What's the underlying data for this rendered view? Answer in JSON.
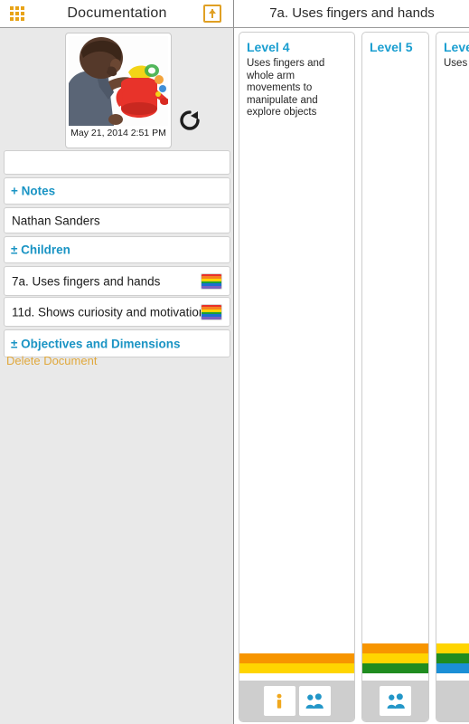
{
  "header": {
    "grid_icon": "grid-menu-icon",
    "doc_title": "Documentation",
    "export_icon": "export-upload-icon",
    "objective_title": "7a. Uses fingers and hands"
  },
  "left_panel": {
    "photo": {
      "caption": "May  21, 2014 2:51 PM",
      "alt": "child-with-red-watering-can-photo"
    },
    "rotate_icon": "rotate-clockwise-icon",
    "rows": [
      {
        "name": "blank-field",
        "value": "",
        "type": "input",
        "placeholder": ""
      },
      {
        "name": "notes-toggle",
        "value": "+ Notes",
        "type": "link"
      },
      {
        "name": "child-name-field",
        "value": "Nathan Sanders",
        "type": "input"
      },
      {
        "name": "children-toggle",
        "value": "± Children",
        "type": "link"
      },
      {
        "name": "objective-7a",
        "value": "7a. Uses fingers and hands",
        "type": "item",
        "badge": "rainbow"
      },
      {
        "name": "objective-11d",
        "value": "11d. Shows curiosity and motivation",
        "type": "item",
        "badge": "rainbow"
      },
      {
        "name": "objectives-dimensions-toggle",
        "value": "± Objectives and Dimensions",
        "type": "link"
      }
    ],
    "delete_label": "Delete Document"
  },
  "right_panel": {
    "columns": [
      {
        "level": "Level 4",
        "description": "Uses fingers and whole arm movements to manipulate and explore objects",
        "bars": [
          "#f79500",
          "#ffd500"
        ],
        "footer_icons": [
          "info-icon",
          "children-people-icon"
        ]
      },
      {
        "level": "Level 5",
        "description": "",
        "bars": [
          "#f79500",
          "#ffd500",
          "#1f8c1f"
        ],
        "footer_icons": [
          "children-people-icon"
        ]
      },
      {
        "level": "Leve",
        "description": "Uses finger",
        "bars": [
          "#ffd500",
          "#1f8c1f",
          "#1b8fd6"
        ],
        "footer_icons": []
      }
    ]
  },
  "rainbow_badge_colors": [
    "#e8302a",
    "#f58220",
    "#ffd400",
    "#18a03a",
    "#1b6fd0",
    "#7a5fc0"
  ],
  "colors": {
    "accent_orange": "#e0a024",
    "link_blue": "#1a94c4",
    "level_blue": "#1a9ed0",
    "delete_orange": "#e0a83c",
    "panel_bg": "#e9e9e9",
    "footer_gray": "#cecece"
  }
}
